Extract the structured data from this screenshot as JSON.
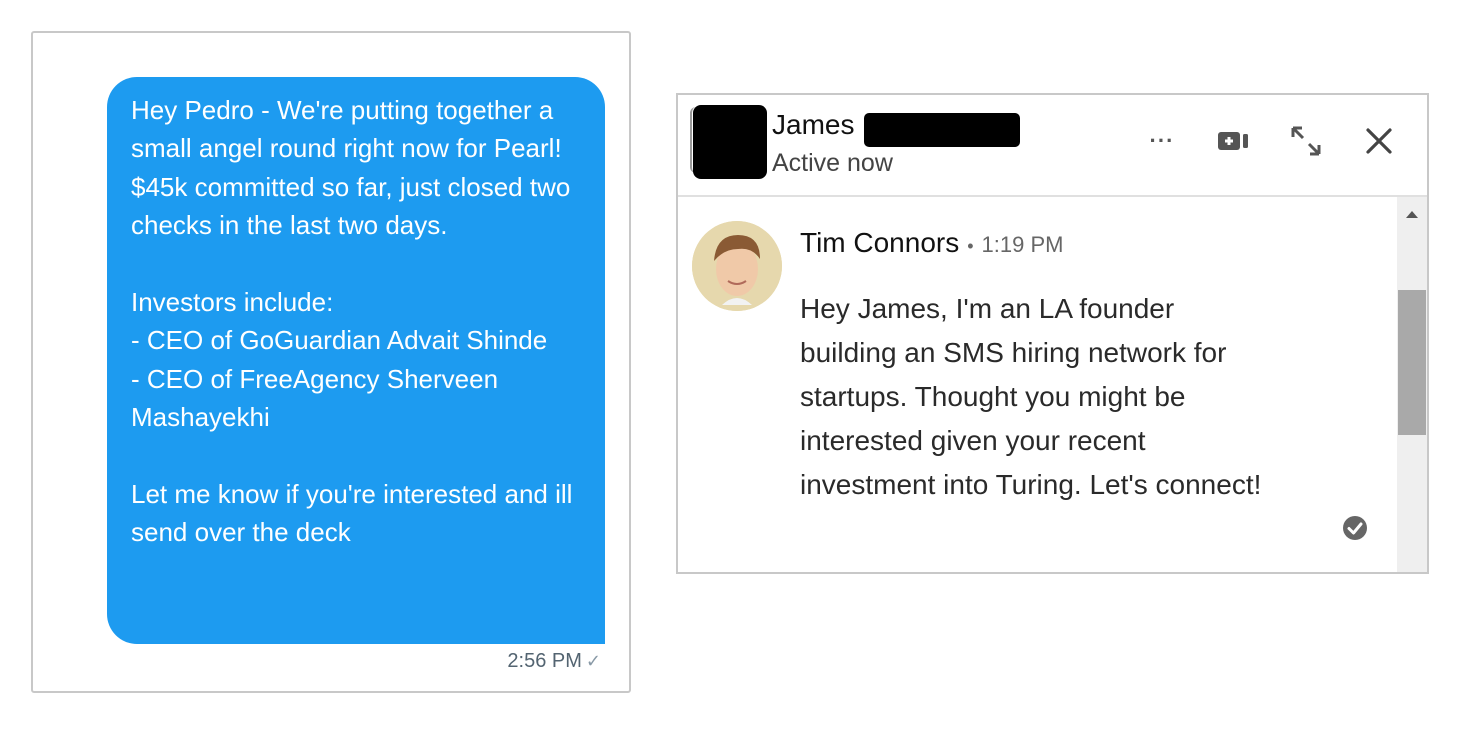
{
  "twitter_dm": {
    "message": "Hey Pedro - We're putting together a small angel round right now for Pearl! $45k committed so far, just closed two checks in the last two days.\n\nInvestors include:\n- CEO of GoGuardian Advait Shinde\n- CEO of FreeAgency Sherveen Mashayekhi\n\nLet me know if you're interested and ill send over the deck",
    "time": "2:56 PM",
    "sent_icon": "checkmark-icon",
    "bubble_color": "#1d9bf0"
  },
  "linkedin_chat": {
    "header": {
      "name": "James",
      "status": "Active now",
      "more_icon": "more-icon",
      "video_icon": "video-call-icon",
      "expand_icon": "expand-icon",
      "close_icon": "close-icon"
    },
    "message": {
      "sender": "Tim Connors",
      "separator": "•",
      "time": "1:19 PM",
      "text": "Hey James, I'm an LA founder building an SMS hiring network for startups. Thought you might be interested given your recent investment into Turing. Let's connect!",
      "read_icon": "read-receipt-icon"
    }
  },
  "icons": {
    "more": "···"
  }
}
